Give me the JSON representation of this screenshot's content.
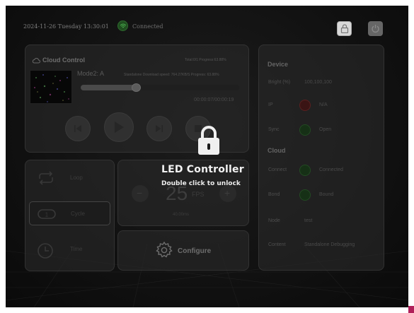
{
  "statusbar": {
    "datetime": "2024-11-26 Tuesday 13:30:01",
    "connection": "Connected"
  },
  "cloud": {
    "title": "Cloud Control",
    "stats": "Total:0/1  Progress:63.88%",
    "mode": "Mode2:  A",
    "status": "Standalone Download speed: 764.27KB/S Progress: 63.88%",
    "progress_fraction": 0.35,
    "time": "00:00:07/00:00:19"
  },
  "modes": {
    "loop": "Loop",
    "cycle": "Cycle",
    "time": "Time"
  },
  "fps": {
    "value": "25",
    "unit": "FPS",
    "ms": "40.00ms"
  },
  "configure": {
    "label": "Configure"
  },
  "device": {
    "heading": "Device",
    "bright_label": "Bright (%)",
    "bright_value": "100,100,100",
    "ip_label": "IP",
    "ip_value": "N/A",
    "sync_label": "Sync",
    "sync_value": "Open"
  },
  "cloud_section": {
    "heading": "Cloud",
    "connect_label": "Connect",
    "connect_value": "Connected",
    "bond_label": "Bond",
    "bond_value": "Bound",
    "node_label": "Node",
    "node_value": "test",
    "content_label": "Content",
    "content_value": "Standalone Debugging"
  },
  "lock": {
    "title": "LED Controller",
    "hint": "Double click to unlock"
  },
  "colors": {
    "ok": "#2e7d32",
    "error": "#b71c1c",
    "lock_button": "#d9d9d9"
  }
}
